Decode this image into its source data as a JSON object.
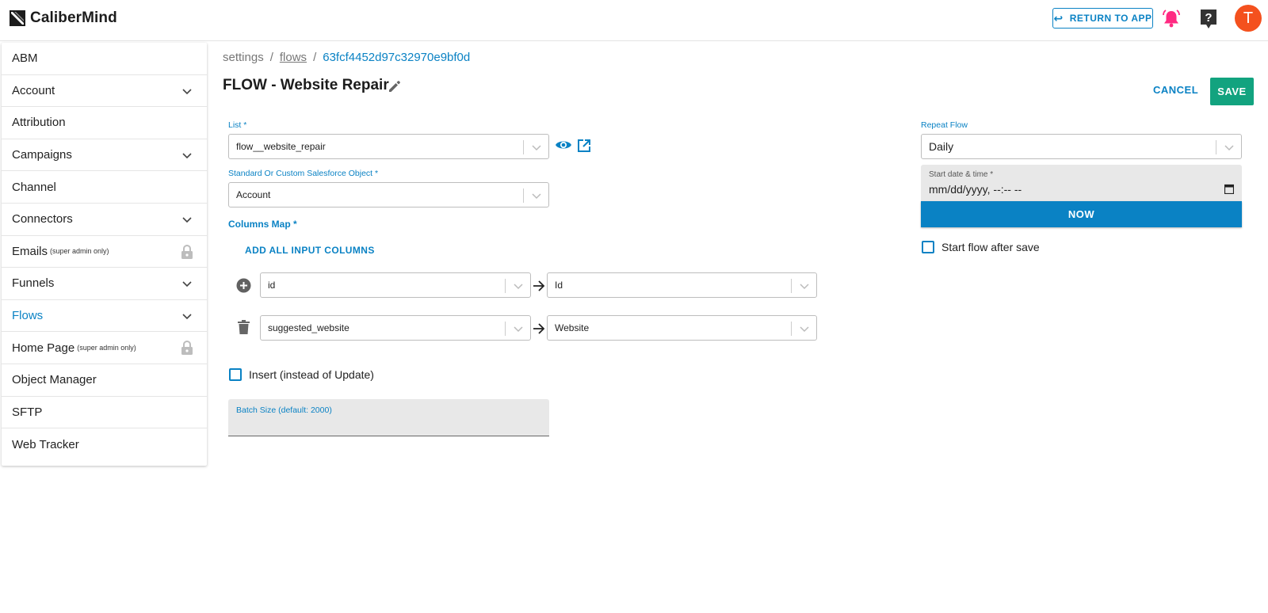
{
  "header": {
    "brand": "CaliberMind",
    "return_label": "RETURN TO APP",
    "avatar_initial": "T",
    "bell_color": "#ff2a82"
  },
  "sidebar": {
    "items": [
      {
        "label": "ABM",
        "note": "",
        "chevron": false,
        "locked": false,
        "active": false
      },
      {
        "label": "Account",
        "note": "",
        "chevron": true,
        "locked": false,
        "active": false
      },
      {
        "label": "Attribution",
        "note": "",
        "chevron": false,
        "locked": false,
        "active": false
      },
      {
        "label": "Campaigns",
        "note": "",
        "chevron": true,
        "locked": false,
        "active": false
      },
      {
        "label": "Channel",
        "note": "",
        "chevron": false,
        "locked": false,
        "active": false
      },
      {
        "label": "Connectors",
        "note": "",
        "chevron": true,
        "locked": false,
        "active": false
      },
      {
        "label": "Emails",
        "note": "(super admin only)",
        "chevron": false,
        "locked": true,
        "active": false
      },
      {
        "label": "Funnels",
        "note": "",
        "chevron": true,
        "locked": false,
        "active": false
      },
      {
        "label": "Flows",
        "note": "",
        "chevron": true,
        "locked": false,
        "active": true
      },
      {
        "label": "Home Page",
        "note": "(super admin only)",
        "chevron": false,
        "locked": true,
        "active": false
      },
      {
        "label": "Object Manager",
        "note": "",
        "chevron": false,
        "locked": false,
        "active": false
      },
      {
        "label": "SFTP",
        "note": "",
        "chevron": false,
        "locked": false,
        "active": false
      },
      {
        "label": "Web Tracker",
        "note": "",
        "chevron": false,
        "locked": false,
        "active": false
      }
    ]
  },
  "breadcrumb": {
    "root": "settings",
    "sep": "/",
    "section": "flows",
    "current": "63fcf4452d97c32970e9bf0d"
  },
  "page": {
    "title": "FLOW - Website Repair",
    "cancel_label": "CANCEL",
    "save_label": "SAVE"
  },
  "form": {
    "list_label": "List *",
    "list_value": "flow__website_repair",
    "object_label": "Standard Or Custom Salesforce Object *",
    "object_value": "Account",
    "columns_map_label": "Columns Map *",
    "add_all_label": "ADD ALL INPUT COLUMNS",
    "mappings": [
      {
        "source": "id",
        "target": "Id"
      },
      {
        "source": "suggested_website",
        "target": "Website"
      }
    ],
    "insert_label": "Insert (instead of Update)",
    "batch_label": "Batch Size (default: 2000)"
  },
  "schedule": {
    "repeat_label": "Repeat Flow",
    "repeat_value": "Daily",
    "date_label": "Start date & time *",
    "date_placeholder": "mm/dd/yyyy, --:-- --",
    "now_label": "NOW",
    "start_after_save_label": "Start flow after save"
  },
  "colors": {
    "accent": "#0a82c4",
    "save": "#12a37f",
    "avatar": "#f4511e"
  }
}
